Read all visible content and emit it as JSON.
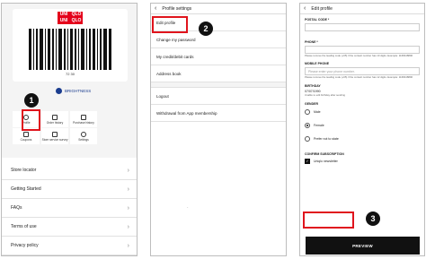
{
  "panel1": {
    "logo": [
      "UNI",
      "QLO",
      "UNI",
      "QLO"
    ],
    "barcode_number": "72 30",
    "brightness_label": "BRIGHTNESS",
    "grid": [
      {
        "label": "Profile",
        "icon": "person-icon"
      },
      {
        "label": "Order history",
        "icon": "receipt-icon"
      },
      {
        "label": "Purchase history",
        "icon": "bag-icon"
      },
      {
        "label": "Coupons",
        "icon": "coupon-icon"
      },
      {
        "label": "Store service survey",
        "icon": "survey-icon"
      },
      {
        "label": "Settings",
        "icon": "gear-icon"
      }
    ],
    "list": [
      "Store locator",
      "Getting Started",
      "FAQs",
      "Terms of use",
      "Privacy policy"
    ]
  },
  "panel2": {
    "title": "Profile settings",
    "rows": [
      "Edit profile",
      "Change my password",
      "My credit/debit cards",
      "Address book"
    ],
    "rows2": [
      "Logout",
      "Withdrawal from App membership"
    ],
    "dash": "-"
  },
  "panel3": {
    "title": "Edit profile",
    "postal_label": "POSTAL CODE *",
    "phone_label": "PHONE *",
    "phone_hint": "Please remove the leading code (+65) if the contact number has 10 digits. Example: 1168448896",
    "mobile_label": "MOBILE PHONE",
    "mobile_placeholder": "Please enter your phone number.",
    "mobile_hint": "Please remove the leading code (+65) if the contact number has 12 digits. Example: 1168448896",
    "birthday_label": "BIRTHDAY",
    "birthday_value": "07/07/1990",
    "birthday_hint": "Unable to edit birthday after sending",
    "gender_label": "GENDER",
    "genders": [
      "Male",
      "Female",
      "Prefer not to state"
    ],
    "selected_gender": "Female",
    "subscription_label": "CONFIRM SUBSCRIPTION",
    "newsletter_label": "Uniqlo newsletter",
    "preview_label": "PREVIEW"
  },
  "steps": [
    "1",
    "2",
    "3"
  ],
  "colors": {
    "accent": "#e0141d",
    "brand": "#e4001b",
    "dark": "#111111"
  }
}
